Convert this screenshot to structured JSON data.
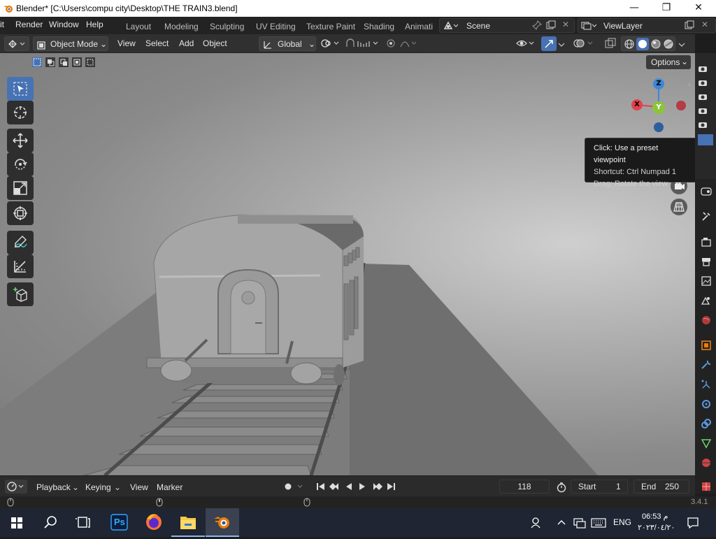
{
  "window": {
    "title": "Blender* [C:\\Users\\compu city\\Desktop\\THE TRAIN3.blend]",
    "minimize": "—",
    "maximize": "❐",
    "close": "✕"
  },
  "menu": {
    "items": [
      "it",
      "Render",
      "Window",
      "Help"
    ]
  },
  "workspaces": {
    "tabs": [
      "Layout",
      "Modeling",
      "Sculpting",
      "UV Editing",
      "Texture Paint",
      "Shading",
      "Animati"
    ]
  },
  "scene": {
    "name": "Scene",
    "view_layer": "ViewLayer"
  },
  "viewport_header": {
    "mode": "Object Mode",
    "menus": [
      "View",
      "Select",
      "Add",
      "Object"
    ],
    "orientation": "Global",
    "options_label": "Options"
  },
  "tooltip": {
    "line1": "Click: Use a preset viewpoint",
    "line2": "Shortcut: Ctrl Numpad 1",
    "line3": "Drag: Rotate the view"
  },
  "gizmo": {
    "x_label": "X",
    "y_label": "Y",
    "z_label": "Z",
    "x_color": "#e0434d",
    "y_color": "#8cc43c",
    "z_color": "#3e87d8"
  },
  "timeline": {
    "playback": "Playback",
    "keying": "Keying",
    "view": "View",
    "marker": "Marker",
    "current_frame": "118",
    "start_label": "Start",
    "start_value": "1",
    "end_label": "End",
    "end_value": "250"
  },
  "statusbar": {
    "version": "3.4.1"
  },
  "taskbar": {
    "language": "ENG",
    "time": "06:53 م",
    "date": "٢٠٢٣/٠٤/٢٠",
    "ps_label": "Ps"
  },
  "colors": {
    "accent": "#4772b3",
    "blender_orange": "#e87d0d"
  }
}
